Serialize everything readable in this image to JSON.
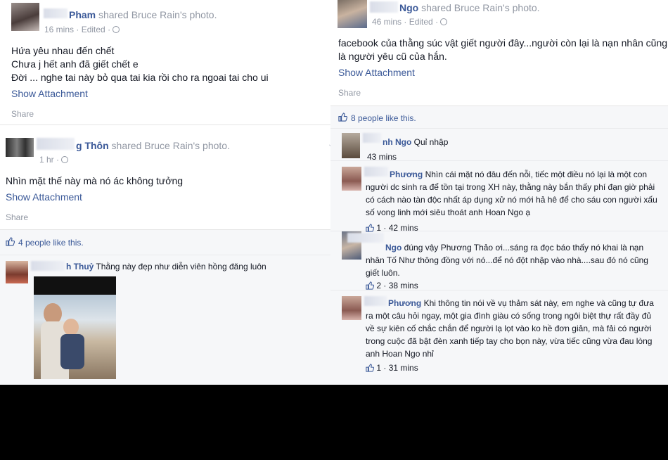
{
  "left": {
    "post1": {
      "name": "Pham",
      "shared": "shared Bruce Rain's photo.",
      "time": "16 mins",
      "edited": "Edited",
      "lines": [
        "Hứa yêu nhau đến chết",
        "Chưa j hết anh đã giết chết e",
        "Đời ... nghe tai này bỏ qua tai kia rồi cho ra ngoai tai cho ui"
      ],
      "show_attachment": "Show Attachment",
      "share": "Share"
    },
    "post2": {
      "name": "g Thôn",
      "shared": "shared Bruce Rain's photo.",
      "time": "1 hr",
      "text": "Nhìn mặt thế này mà nó ác không tưởng",
      "show_attachment": "Show Attachment",
      "share": "Share",
      "likes": "4 people like this.",
      "comment": {
        "name": "h Thuỷ",
        "text": "Thằng này đẹp như diễn viên hồng đăng luôn"
      }
    }
  },
  "right": {
    "post": {
      "name": "Ngo",
      "shared": "shared Bruce Rain's photo.",
      "time": "46 mins",
      "edited": "Edited",
      "lines": [
        "facebook của thằng súc vật giết người đây...người còn lại là nạn nhân cũng",
        "là người yêu cũ của hắn."
      ],
      "show_attachment": "Show Attachment",
      "share": "Share",
      "likes": "8 people like this."
    },
    "comments": [
      {
        "name": "nh Ngo",
        "lines": [
          "Quỉ nhập"
        ],
        "meta": "43 mins",
        "likes": ""
      },
      {
        "name": "Phương",
        "lines": [
          "Nhìn cái mặt nó đâu đến nỗi, tiếc một điều nó lại là một con",
          "người dc sinh ra để tồn tại trong XH này, thằng này bắn thấy phí đạn giờ phải",
          "có cách nào tàn độc nhất áp dụng xử nó mới hả hê để cho sáu con người xấu",
          "số vong linh mới siêu thoát anh Hoan Ngo ạ"
        ],
        "meta": "42 mins",
        "likes": "1"
      },
      {
        "name": "Ngo",
        "lines": [
          "đúng vậy Phương Thảo ơi...sáng ra đọc báo thấy nó khai là nạn",
          "nhân Tố Như thông đồng với nó...để nó đột nhập vào nhà....sau đó nó cũng",
          "giết luôn."
        ],
        "meta": "38 mins",
        "likes": "2"
      },
      {
        "name": "Phương",
        "lines": [
          "Khi thông tin nói về vụ thảm sát này, em nghe và cũng tự đưa",
          "ra một câu hỏi ngay, một gia đình giàu có sống trong ngôi biệt thự rất đầy đủ",
          "về sự kiên cố chắc chắn để người lạ lọt vào ko hề đơn giản, mà fải có người",
          "trong cuộc đã bật đèn xanh tiếp tay cho bọn này, vừa tiếc cũng vừa đau lòng",
          "anh Hoan Ngo nhỉ"
        ],
        "meta": "31 mins",
        "likes": "1"
      }
    ]
  },
  "icons": {
    "like": "thumbs-up-icon",
    "audience": "globe-icon"
  },
  "colors": {
    "link": "#3b5998",
    "meta": "#9197a3",
    "likes_bg": "#f6f7f9",
    "band": "#000000"
  }
}
